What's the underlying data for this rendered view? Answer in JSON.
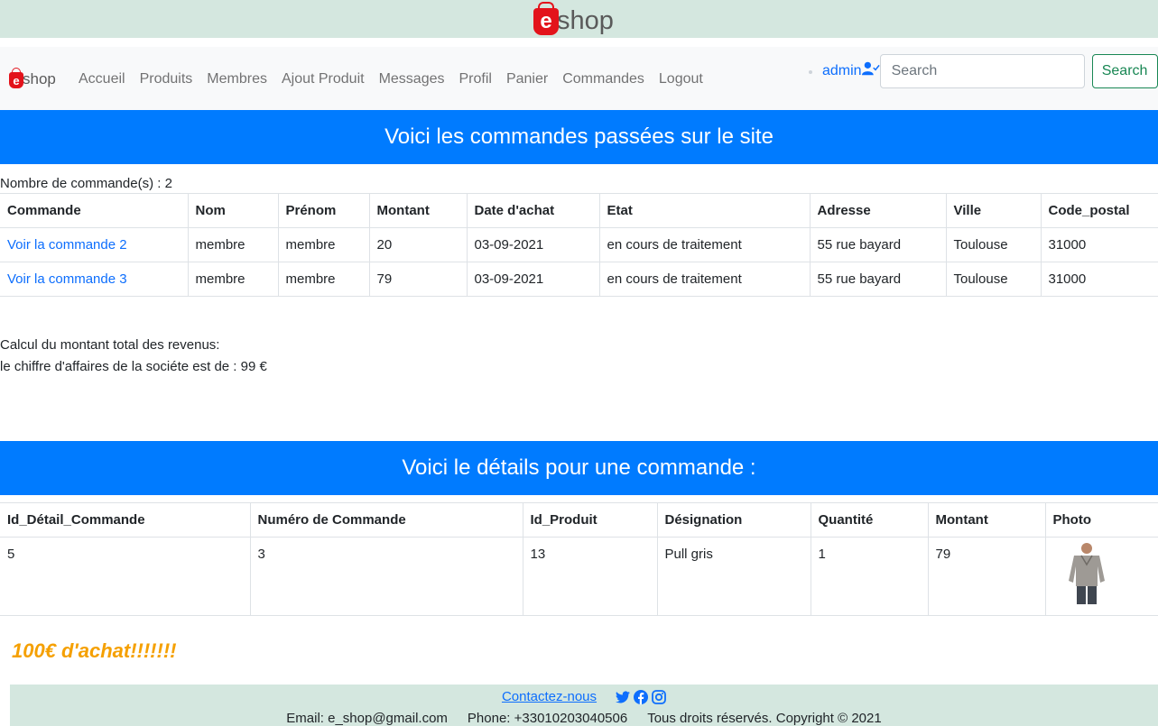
{
  "brand": {
    "logo_letter": "e",
    "logo_text": "shop"
  },
  "nav": {
    "links": [
      "Accueil",
      "Produits",
      "Membres",
      "Ajout Produit",
      "Messages",
      "Profil",
      "Panier",
      "Commandes",
      "Logout"
    ],
    "admin_label": "admin",
    "search_placeholder": "Search",
    "search_button": "Search"
  },
  "orders_section": {
    "heading": "Voici les commandes passées sur le site",
    "count_text": "Nombre de commande(s) : 2",
    "columns": [
      "Commande",
      "Nom",
      "Prénom",
      "Montant",
      "Date d'achat",
      "Etat",
      "Adresse",
      "Ville",
      "Code_postal"
    ],
    "rows": [
      [
        "Voir la commande 2",
        "membre",
        "membre",
        "20",
        "03-09-2021",
        "en cours de traitement",
        "55 rue bayard",
        "Toulouse",
        "31000"
      ],
      [
        "Voir la commande 3",
        "membre",
        "membre",
        "79",
        "03-09-2021",
        "en cours de traitement",
        "55 rue bayard",
        "Toulouse",
        "31000"
      ]
    ],
    "revenue_label": "Calcul du montant total des revenus:",
    "revenue_text": "le chiffre d'affaires de la sociéte est de : 99 €"
  },
  "details_section": {
    "heading": "Voici le détails pour une commande :",
    "columns": [
      "Id_Détail_Commande",
      "Numéro de Commande",
      "Id_Produit",
      "Désignation",
      "Quantité",
      "Montant",
      "Photo"
    ],
    "rows": [
      [
        "5",
        "3",
        "13",
        "Pull gris",
        "1",
        "79"
      ]
    ]
  },
  "promo_text": "100€ d'achat!!!!!!!",
  "footer": {
    "contact_link": "Contactez-nous",
    "social_icons": [
      "twitter-icon",
      "facebook-icon",
      "instagram-icon"
    ],
    "email": "Email: e_shop@gmail.com",
    "phone": "Phone: +33010203040506",
    "copyright": "Tous droits réservés. Copyright © 2021"
  },
  "colors": {
    "accent_blue": "#007bff",
    "banner_green": "#d4e7df",
    "promo_orange": "#f5a000",
    "search_green": "#198754",
    "logo_red": "#e3131b"
  }
}
